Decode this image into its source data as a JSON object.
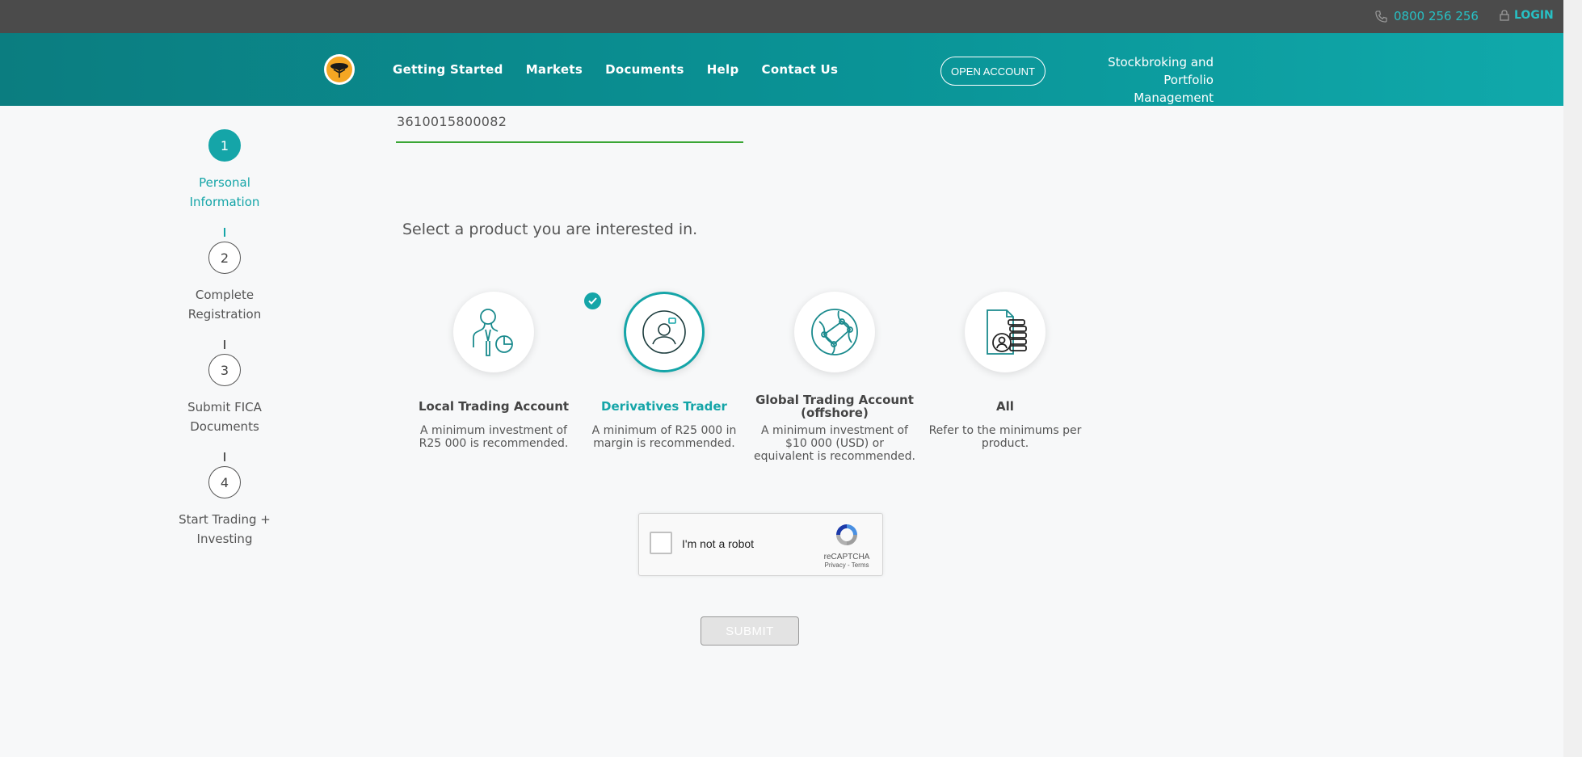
{
  "topbar": {
    "phone": "0800 256 256",
    "login": "LOGIN"
  },
  "nav": {
    "items": [
      "Getting Started",
      "Markets",
      "Documents",
      "Help",
      "Contact Us"
    ],
    "open_account": "OPEN ACCOUNT",
    "tagline_line1": "Stockbroking and",
    "tagline_line2": "Portfolio Management"
  },
  "steps": [
    {
      "number": "1",
      "line1": "Personal",
      "line2": "Information",
      "active": true
    },
    {
      "number": "2",
      "line1": "Complete",
      "line2": "Registration",
      "active": false
    },
    {
      "number": "3",
      "line1": "Submit FICA",
      "line2": "Documents",
      "active": false
    },
    {
      "number": "4",
      "line1": "Start Trading +",
      "line2": "Investing",
      "active": false
    }
  ],
  "form": {
    "id_value": "3610015800082",
    "prompt": "Select a product you are interested in."
  },
  "products": [
    {
      "name": "Local Trading Account",
      "desc": "A minimum investment of R25 000 is recommended.",
      "icon": "person-chart-icon",
      "selected": false
    },
    {
      "name": "Derivatives Trader",
      "desc": "A minimum of R25 000 in margin is recommended.",
      "icon": "trader-icon",
      "selected": true
    },
    {
      "name": "Global Trading Account (offshore)",
      "desc": "A minimum investment of $10 000 (USD) or equivalent is recommended.",
      "icon": "globe-network-icon",
      "selected": false
    },
    {
      "name": "All",
      "desc": "Refer to the minimums per product.",
      "icon": "document-coins-icon",
      "selected": false
    }
  ],
  "recaptcha": {
    "label": "I'm not a robot",
    "brand": "reCAPTCHA",
    "links": "Privacy - Terms"
  },
  "submit": "SUBMIT",
  "colors": {
    "teal": "#15a5a8",
    "topbar": "#4b4b4b",
    "accent_link": "#27c0c4",
    "field_underline": "#3aa635"
  }
}
